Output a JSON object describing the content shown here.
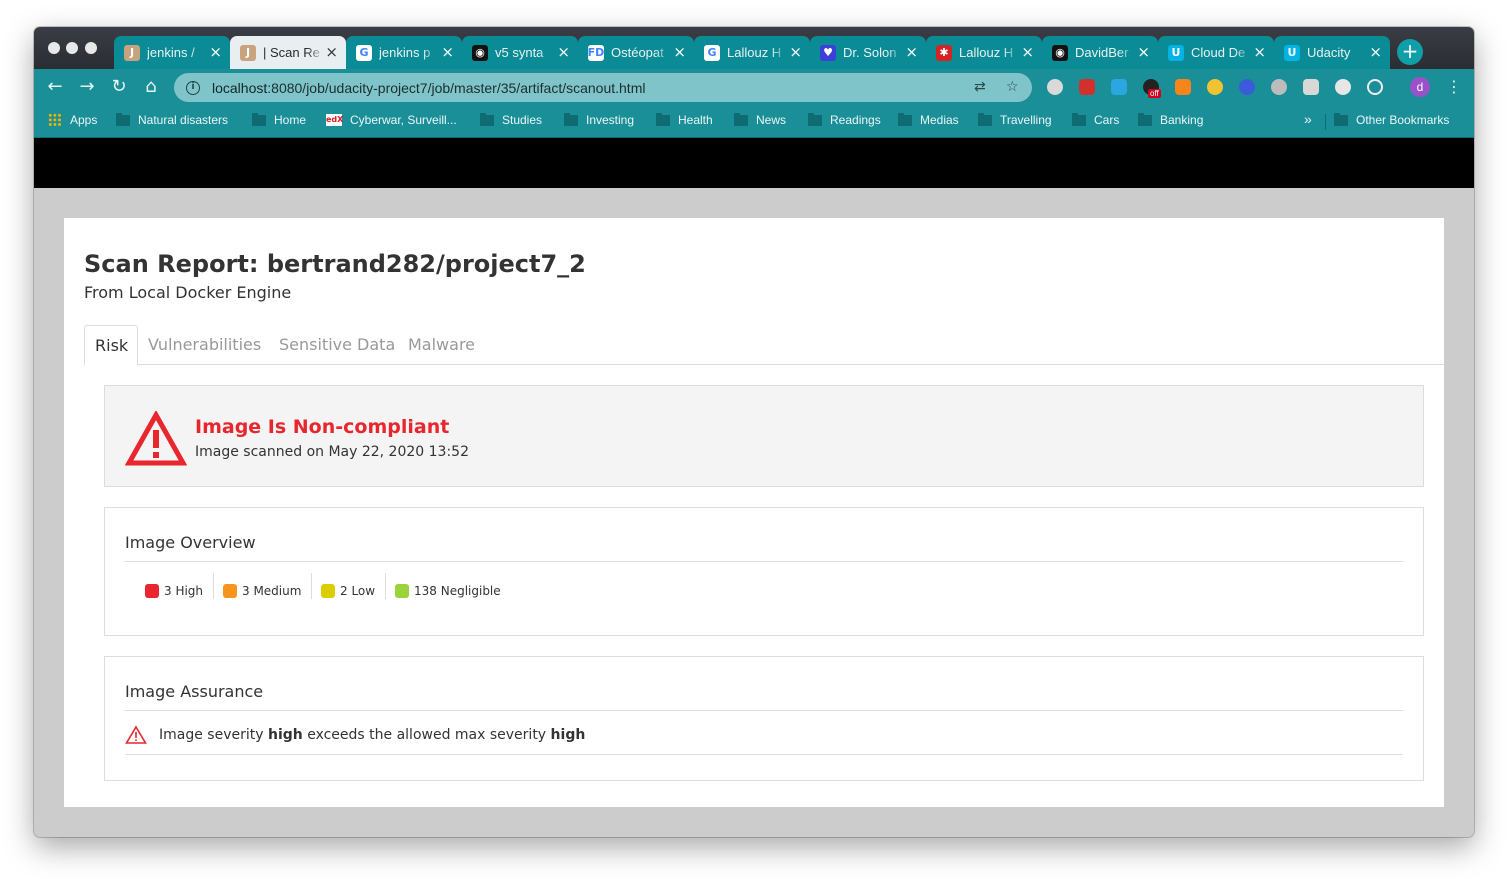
{
  "browser": {
    "tabs": [
      {
        "label": "jenkins /",
        "fav_color": "#c9a27e",
        "fav_glyph": "J"
      },
      {
        "label": "| Scan Re",
        "fav_color": "#c9a27e",
        "fav_glyph": "J"
      },
      {
        "label": "jenkins p",
        "fav_color": "#ffffff",
        "fav_glyph": "G"
      },
      {
        "label": "v5 synta",
        "fav_color": "#111111",
        "fav_glyph": "◉"
      },
      {
        "label": "Ostéopat",
        "fav_color": "#ffffff",
        "fav_glyph": "FD"
      },
      {
        "label": "Lallouz H",
        "fav_color": "#ffffff",
        "fav_glyph": "G"
      },
      {
        "label": "Dr. Solon",
        "fav_color": "#3c3fd8",
        "fav_glyph": "♥"
      },
      {
        "label": "Lallouz H",
        "fav_color": "#d32323",
        "fav_glyph": "✱"
      },
      {
        "label": "DavidBer",
        "fav_color": "#111111",
        "fav_glyph": "◉"
      },
      {
        "label": "Cloud De",
        "fav_color": "#02b3e4",
        "fav_glyph": "U"
      },
      {
        "label": "Udacity",
        "fav_color": "#02b3e4",
        "fav_glyph": "U"
      }
    ],
    "active_tab_index": 1,
    "url_host": "localhost",
    "url_path": ":8080/job/udacity-project7/job/master/35/artifact/scanout.html",
    "avatar_letter": "d",
    "extension_badge": "off",
    "bookmarks": [
      {
        "label": "Apps",
        "kind": "apps"
      },
      {
        "label": "Natural disasters",
        "kind": "folder"
      },
      {
        "label": "Home",
        "kind": "folder"
      },
      {
        "label": "Cyberwar, Surveill...",
        "kind": "edx"
      },
      {
        "label": "Studies",
        "kind": "folder"
      },
      {
        "label": "Investing",
        "kind": "folder"
      },
      {
        "label": "Health",
        "kind": "folder"
      },
      {
        "label": "News",
        "kind": "folder"
      },
      {
        "label": "Readings",
        "kind": "folder"
      },
      {
        "label": "Medias",
        "kind": "folder"
      },
      {
        "label": "Travelling",
        "kind": "folder"
      },
      {
        "label": "Cars",
        "kind": "folder"
      },
      {
        "label": "Banking",
        "kind": "folder"
      }
    ],
    "bookmarks_overflow": "»",
    "other_bookmarks": "Other Bookmarks"
  },
  "report": {
    "title": "Scan Report: bertrand282/project7_2",
    "subtitle": "From Local Docker Engine",
    "tabs": [
      "Risk",
      "Vulnerabilities",
      "Sensitive Data",
      "Malware"
    ],
    "active_tab": "Risk",
    "alert": {
      "title": "Image Is Non-compliant",
      "scanned": "Image scanned on May 22, 2020 13:52",
      "color": "#e8262d"
    },
    "overview": {
      "title": "Image Overview",
      "severities": [
        {
          "label": "3 High",
          "color": "#e8262d"
        },
        {
          "label": "3 Medium",
          "color": "#f7941d"
        },
        {
          "label": "2 Low",
          "color": "#dccd00"
        },
        {
          "label": "138 Negligible",
          "color": "#9ad33a"
        }
      ]
    },
    "assurance": {
      "title": "Image Assurance",
      "prefix": "Image severity",
      "severity": "high",
      "middle": "exceeds the allowed max severity",
      "max_severity": "high"
    }
  }
}
